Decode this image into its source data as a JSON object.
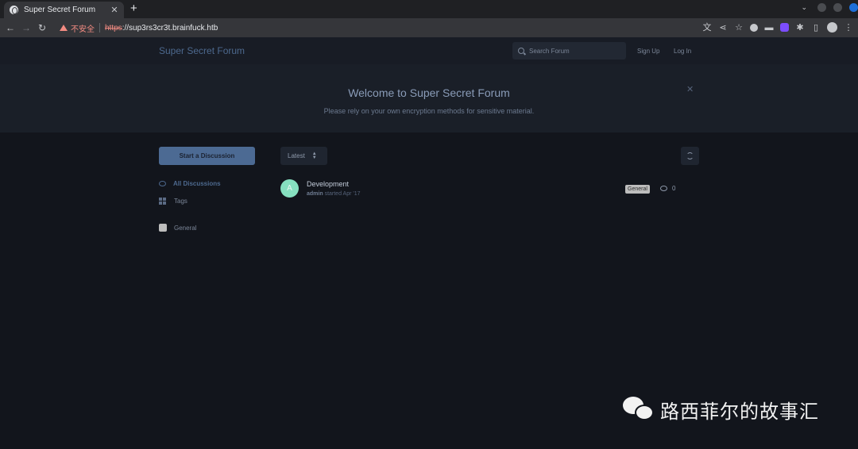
{
  "browser": {
    "tab_title": "Super Secret Forum",
    "insecure_label": "不安全",
    "url_scheme": "https",
    "url_host": "://sup3rs3cr3t.brainfuck.htb"
  },
  "header": {
    "brand": "Super Secret Forum",
    "search_placeholder": "Search Forum",
    "signup": "Sign Up",
    "login": "Log In"
  },
  "hero": {
    "title": "Welcome to Super Secret Forum",
    "description": "Please rely on your own encryption methods for sensitive material."
  },
  "sidebar": {
    "start_button": "Start a Discussion",
    "items": [
      {
        "label": "All Discussions",
        "icon": "chat-icon",
        "active": true
      },
      {
        "label": "Tags",
        "icon": "grid-icon",
        "active": false
      }
    ],
    "tags": [
      {
        "label": "General",
        "color": "#bdbdbd"
      }
    ]
  },
  "toolbar": {
    "sort_label": "Latest"
  },
  "discussions": [
    {
      "avatar_letter": "A",
      "avatar_color": "#86e0c0",
      "title": "Development",
      "author": "admin",
      "meta": " started Apr '17",
      "tag": "General",
      "replies": "0"
    }
  ],
  "watermark": {
    "text": "路西菲尔的故事汇"
  }
}
